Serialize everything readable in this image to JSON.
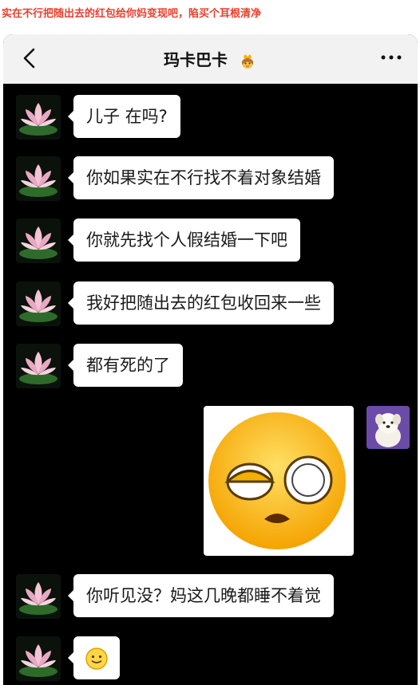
{
  "caption": "实在不行把随出去的红包给你妈变现吧，陷买个耳根清净",
  "header": {
    "title": "玛卡巴卡",
    "title_emoji_icon": "princess-icon",
    "back_icon": "chevron-left-icon",
    "more_icon": "more-dots-icon"
  },
  "colors": {
    "caption": "#e8402e",
    "chat_bg": "#000000",
    "nav_bg": "#f2f2f2",
    "bubble": "#ffffff"
  },
  "messages": [
    {
      "sender": "contact",
      "text": "儿子 在吗?"
    },
    {
      "sender": "contact",
      "text": "你如果实在不行找不着对象结婚"
    },
    {
      "sender": "contact",
      "text": "你就先找个人假结婚一下吧"
    },
    {
      "sender": "contact",
      "text": "我好把随出去的红包收回来一些"
    },
    {
      "sender": "contact",
      "text": "都有死的了"
    },
    {
      "sender": "me",
      "sticker": "shocked-face-sticker"
    },
    {
      "sender": "contact",
      "text": "你听见没？妈这几晚都睡不着觉"
    },
    {
      "sender": "contact",
      "emoji": "🙂"
    }
  ]
}
